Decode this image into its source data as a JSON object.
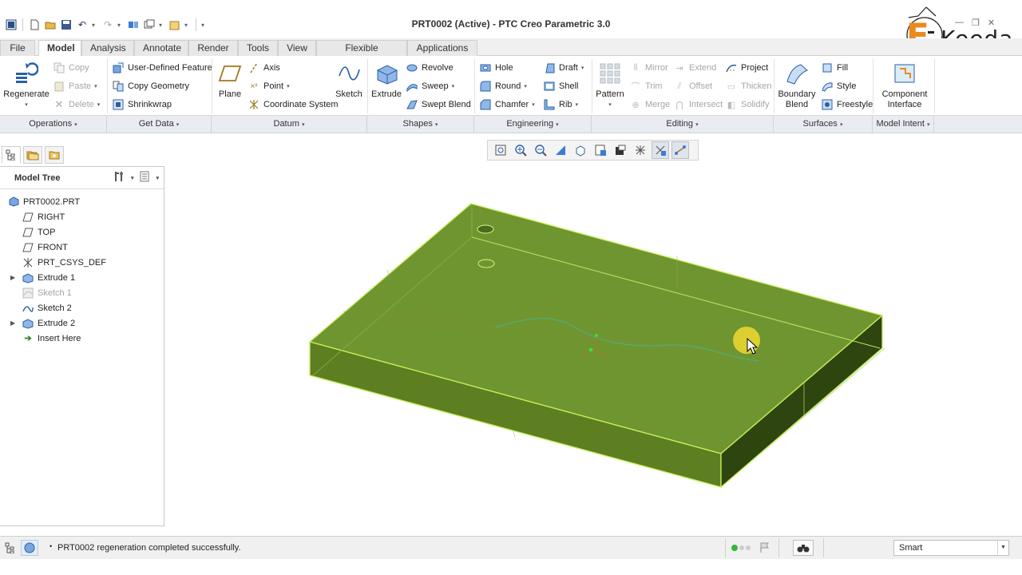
{
  "window": {
    "title": "PRT0002 (Active) - PTC Creo Parametric 3.0"
  },
  "logo": {
    "text": "Keeda",
    "brand_color": "#e98a1e"
  },
  "tabs": [
    {
      "label": "File",
      "id": "file"
    },
    {
      "label": "Model",
      "id": "model",
      "active": true
    },
    {
      "label": "Analysis",
      "id": "analysis"
    },
    {
      "label": "Annotate",
      "id": "annotate"
    },
    {
      "label": "Render",
      "id": "render"
    },
    {
      "label": "Tools",
      "id": "tools"
    },
    {
      "label": "View",
      "id": "view"
    },
    {
      "label": "Flexible Modeling",
      "id": "flexible"
    },
    {
      "label": "Applications",
      "id": "applications"
    }
  ],
  "ribbon": {
    "operations": {
      "regenerate": "Regenerate",
      "copy": "Copy",
      "paste": "Paste",
      "delete": "Delete"
    },
    "getdata": {
      "udf": "User-Defined Feature",
      "copy_geometry": "Copy Geometry",
      "shrinkwrap": "Shrinkwrap"
    },
    "datum": {
      "plane": "Plane",
      "axis": "Axis",
      "point": "Point",
      "csys": "Coordinate System",
      "sketch": "Sketch"
    },
    "shapes": {
      "extrude": "Extrude",
      "revolve": "Revolve",
      "sweep": "Sweep",
      "swept_blend": "Swept Blend"
    },
    "engineering": {
      "hole": "Hole",
      "round": "Round",
      "chamfer": "Chamfer",
      "draft": "Draft",
      "shell": "Shell",
      "rib": "Rib"
    },
    "editing": {
      "pattern": "Pattern",
      "mirror": "Mirror",
      "trim": "Trim",
      "merge": "Merge",
      "extend": "Extend",
      "offset": "Offset",
      "intersect": "Intersect",
      "project": "Project",
      "thicken": "Thicken",
      "solidify": "Solidify"
    },
    "surfaces": {
      "boundary_blend_1": "Boundary",
      "boundary_blend_2": "Blend",
      "fill": "Fill",
      "style": "Style",
      "freestyle": "Freestyle"
    },
    "modelintent": {
      "component_interface_1": "Component",
      "component_interface_2": "Interface"
    }
  },
  "groups": {
    "operations": "Operations",
    "getdata": "Get Data",
    "datum": "Datum",
    "shapes": "Shapes",
    "engineering": "Engineering",
    "editing": "Editing",
    "surfaces": "Surfaces",
    "modelintent": "Model Intent"
  },
  "model_tree": {
    "header": "Model Tree",
    "items": [
      {
        "label": "PRT0002.PRT"
      },
      {
        "label": "RIGHT"
      },
      {
        "label": "TOP"
      },
      {
        "label": "FRONT"
      },
      {
        "label": "PRT_CSYS_DEF"
      },
      {
        "label": "Extrude 1"
      },
      {
        "label": "Sketch 1"
      },
      {
        "label": "Sketch 2"
      },
      {
        "label": "Extrude 2"
      },
      {
        "label": "Insert Here"
      }
    ]
  },
  "status": {
    "message": "PRT0002 regeneration completed successfully.",
    "selection_filter": "Smart"
  },
  "colors": {
    "part_face": "#6b8e2a",
    "part_edge": "#c8f05a",
    "accent": "#1f5aa8"
  }
}
